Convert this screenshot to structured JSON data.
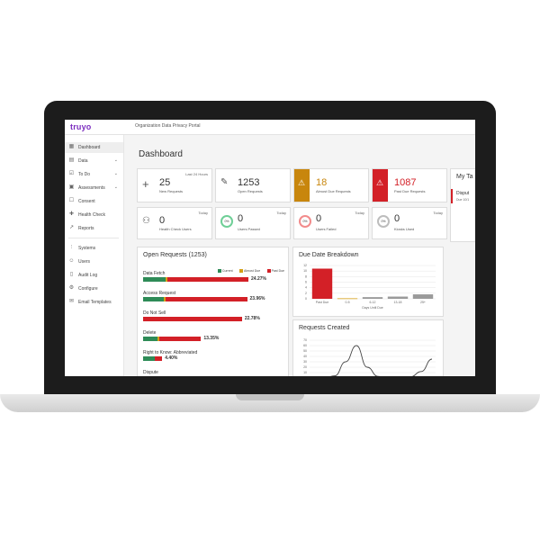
{
  "app": {
    "logo": "truyo",
    "portal_name": "Organization Data Privacy Portal",
    "page_title": "Dashboard"
  },
  "sidebar": {
    "items": [
      {
        "label": "Dashboard",
        "icon": "dashboard-icon"
      },
      {
        "label": "Data",
        "icon": "database-icon"
      },
      {
        "label": "To Do",
        "icon": "todo-icon"
      },
      {
        "label": "Assessments",
        "icon": "assessments-icon"
      },
      {
        "label": "Consent",
        "icon": "consent-icon"
      },
      {
        "label": "Health Check",
        "icon": "health-check-icon"
      },
      {
        "label": "Reports",
        "icon": "reports-icon"
      },
      {
        "label": "Systems",
        "icon": "systems-icon"
      },
      {
        "label": "Users",
        "icon": "users-icon"
      },
      {
        "label": "Audit Log",
        "icon": "audit-log-icon"
      },
      {
        "label": "Configure",
        "icon": "configure-icon"
      },
      {
        "label": "Email Templates",
        "icon": "email-icon"
      }
    ]
  },
  "stats": {
    "new_requests": {
      "value": "25",
      "label": "New Requests",
      "period": "Last 24 Hours"
    },
    "open_requests": {
      "value": "1253",
      "label": "Open Requests"
    },
    "almost_due": {
      "value": "18",
      "label": "Almost Due Requests"
    },
    "past_due": {
      "value": "1087",
      "label": "Past Due Requests"
    },
    "my_tasks": {
      "title": "My Ta",
      "item": "Disput",
      "item_sub": "Due 10/1"
    }
  },
  "health": {
    "health_check_users": {
      "value": "0",
      "label": "Health Check Users",
      "period": "Today"
    },
    "users_passed": {
      "value": "0",
      "label": "Users Passed",
      "period": "Today",
      "pct": "0%"
    },
    "users_failed": {
      "value": "0",
      "label": "Users Failed",
      "period": "Today",
      "pct": "0%"
    },
    "kiosks_used": {
      "value": "0",
      "label": "Kiosks Used",
      "period": "Today",
      "pct": "0%"
    }
  },
  "open_requests_panel": {
    "title": "Open Requests (1253)",
    "legend": [
      "Current",
      "Almost Due",
      "Past Due"
    ],
    "rows": [
      {
        "label": "Data Fetch",
        "pct": "24.27%",
        "current": 0.21,
        "almost": 0.02,
        "past": 0.77
      },
      {
        "label": "Access Request",
        "pct": "23.96%",
        "current": 0.2,
        "almost": 0.02,
        "past": 0.78
      },
      {
        "label": "Do Not Sell",
        "pct": "22.78%",
        "current": 0.0,
        "almost": 0.0,
        "past": 1.0
      },
      {
        "label": "Delete",
        "pct": "13.35%",
        "current": 0.25,
        "almost": 0.03,
        "past": 0.72
      },
      {
        "label": "Right to Know: Abbreviated",
        "pct": "4.40%",
        "current": 0.62,
        "almost": 0.0,
        "past": 0.38
      },
      {
        "label": "Dispute",
        "pct": "",
        "current": 0,
        "almost": 0,
        "past": 0
      }
    ]
  },
  "colors": {
    "current": "#2e8b57",
    "almost_due": "#d4a017",
    "past_due": "#d32027",
    "almost_card": "#c8860d",
    "brand": "#7b2cbf"
  },
  "due_date_chart": {
    "title": "Due Date Breakdown",
    "chart_data": {
      "type": "bar",
      "categories": [
        "Past Due",
        "0-5",
        "6-12",
        "13-18",
        "25+"
      ],
      "values": [
        1087,
        18,
        60,
        80,
        160
      ],
      "colors": [
        "#d32027",
        "#d4a017",
        "#9a9a9a",
        "#9a9a9a",
        "#9a9a9a"
      ],
      "xlabel": "Days Until Due",
      "ylim": [
        0,
        1200
      ],
      "ytick_labels": [
        "0",
        "2",
        "4",
        "6",
        "8",
        "10",
        "12"
      ]
    }
  },
  "requests_created_chart": {
    "title": "Requests Created",
    "chart_data": {
      "type": "line",
      "x": [
        0,
        1,
        2,
        3,
        4,
        5,
        6,
        7,
        8,
        9,
        10,
        11
      ],
      "values": [
        0,
        0,
        4,
        30,
        60,
        20,
        3,
        0,
        0,
        2,
        12,
        35
      ],
      "ylim": [
        0,
        70
      ],
      "ytick_labels": [
        "0",
        "10",
        "20",
        "30",
        "40",
        "50",
        "60",
        "70"
      ]
    }
  }
}
